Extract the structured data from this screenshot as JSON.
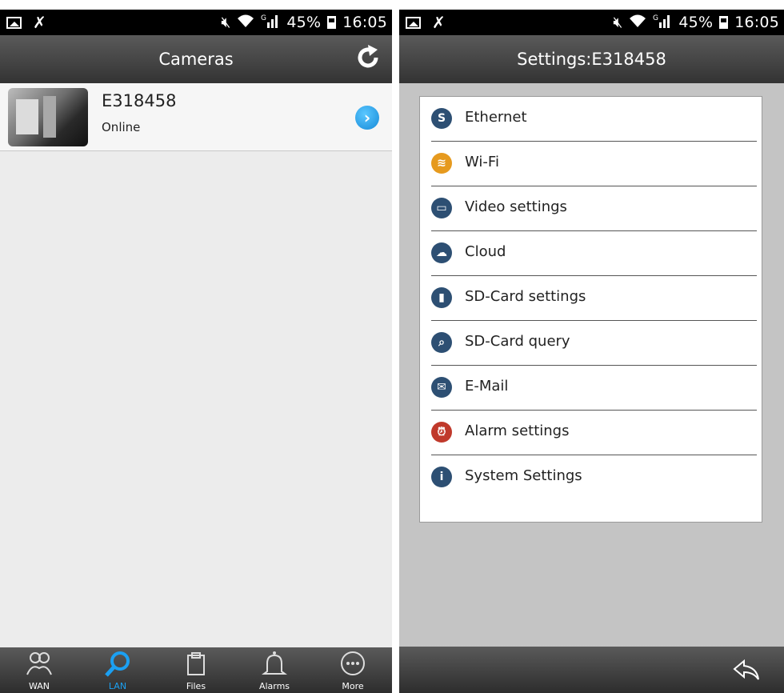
{
  "left_screen": {
    "status_bar": {
      "battery": "45%",
      "time": "16:05",
      "network": "G"
    },
    "title": "Cameras",
    "camera": {
      "name": "E318458",
      "status": "Online"
    },
    "tabs": [
      {
        "label": "WAN",
        "icon": "users-icon"
      },
      {
        "label": "LAN",
        "icon": "search-icon",
        "active": true
      },
      {
        "label": "Files",
        "icon": "clipboard-icon"
      },
      {
        "label": "Alarms",
        "icon": "bell-icon"
      },
      {
        "label": "More",
        "icon": "more-icon"
      }
    ]
  },
  "right_screen": {
    "status_bar": {
      "battery": "45%",
      "time": "16:05",
      "network": "G"
    },
    "title": "Settings:E318458",
    "items": [
      {
        "label": "Ethernet",
        "icon": "ethernet-icon",
        "color": "#2d4f73"
      },
      {
        "label": "Wi-Fi",
        "icon": "wifi-icon",
        "color": "#e69a1e"
      },
      {
        "label": "Video settings",
        "icon": "video-icon",
        "color": "#2d4f73"
      },
      {
        "label": "Cloud",
        "icon": "cloud-icon",
        "color": "#2d4f73"
      },
      {
        "label": "SD-Card settings",
        "icon": "sd-card-icon",
        "color": "#2d4f73"
      },
      {
        "label": "SD-Card query",
        "icon": "sd-query-icon",
        "color": "#2d4f73"
      },
      {
        "label": "E-Mail",
        "icon": "email-icon",
        "color": "#2d4f73"
      },
      {
        "label": "Alarm settings",
        "icon": "alarm-icon",
        "color": "#c0392b"
      },
      {
        "label": "System Settings",
        "icon": "info-icon",
        "color": "#2d4f73"
      }
    ]
  }
}
